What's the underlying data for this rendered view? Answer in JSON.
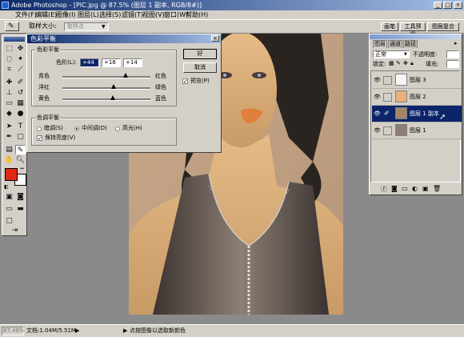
{
  "titlebar": {
    "title": "Adobe Photoshop - [PIC.jpg @ 87.5% (图层 1 副本, RGB/8#)]",
    "minimize": "_",
    "maximize": "□",
    "close": "×"
  },
  "menu": [
    "文件(F)",
    "编辑(E)",
    "图像(I)",
    "图层(L)",
    "选择(S)",
    "滤镜(T)",
    "视图(V)",
    "窗口(W)",
    "帮助(H)"
  ],
  "options": {
    "sample_size_label": "取样大小:",
    "sample_size_value": "取样点",
    "tabs": [
      "画笔",
      "工具预设",
      "图层复合"
    ]
  },
  "dialog": {
    "title": "色彩平衡",
    "balance_group": "色彩平衡",
    "levels_label": "色阶(L):",
    "levels": [
      "+44",
      "+16",
      "+14"
    ],
    "sliders": [
      {
        "left": "青色",
        "right": "红色",
        "value": 44
      },
      {
        "left": "洋红",
        "right": "绿色",
        "value": 16
      },
      {
        "left": "黄色",
        "right": "蓝色",
        "value": 14
      }
    ],
    "tone_group": "色调平衡",
    "tones": [
      "暗调(S)",
      "中间调(D)",
      "高光(H)"
    ],
    "tone_selected": "中间调(D)",
    "preserve_label": "保持亮度(V)",
    "ok": "好",
    "cancel": "取消",
    "preview": "预览(P)"
  },
  "layers_panel": {
    "tabs": [
      "图层",
      "通道",
      "路径"
    ],
    "blend_mode": "正常",
    "opacity_label": "不透明度:",
    "lock_label": "锁定:",
    "fill_label": "填充:",
    "layers": [
      {
        "name": "图层 3",
        "visible": true,
        "selected": false,
        "thumb_color": "#f6f6f6"
      },
      {
        "name": "图层 2",
        "visible": true,
        "selected": false,
        "thumb_color": "#e8b07a"
      },
      {
        "name": "图层 1 副本",
        "visible": true,
        "selected": true,
        "thumb_color": "#a48566"
      },
      {
        "name": "图层 1",
        "visible": true,
        "selected": false,
        "thumb_color": "#8e7f76"
      }
    ]
  },
  "statusbar": {
    "zoom": "87.48%",
    "doc": "文档:1.04M/5.51M",
    "hint": "点按图像以选取新颜色"
  },
  "colors": {
    "foreground": "#e02a18",
    "background": "#ffffff",
    "selection": "#0b246a"
  }
}
